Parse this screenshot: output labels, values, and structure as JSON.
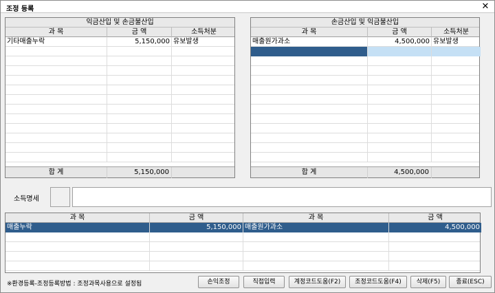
{
  "window": {
    "title": "조정 등록",
    "close_glyph": "✕"
  },
  "left_grid": {
    "title": "익금산입 및 손금불산입",
    "columns": [
      "과    목",
      "금    액",
      "소득처분"
    ],
    "rows": [
      [
        "기타매출누락",
        "5,150,000",
        "유보발생"
      ]
    ],
    "total_label": "합        계",
    "total_value": "5,150,000"
  },
  "right_grid": {
    "title": "손금산입 및 익금불산입",
    "columns": [
      "과    목",
      "금    액",
      "소득처분"
    ],
    "rows": [
      [
        "매출원가과소",
        "4,500,000",
        "유보발생"
      ]
    ],
    "total_label": "합        계",
    "total_value": "4,500,000"
  },
  "income": {
    "label": "소득명세"
  },
  "bottom_grid": {
    "columns": [
      "과    목",
      "금    액",
      "과    목",
      "금    액"
    ],
    "rows": [
      [
        "매출누락",
        "5,150,000",
        "매출원가과소",
        "4,500,000"
      ]
    ]
  },
  "footer": {
    "note": "※환경등록-조정등록방법 : 조정과목사용으로 설정됨",
    "buttons": {
      "adjust": "손익조정",
      "direct": "직접입력",
      "account_help": "계정코드도움(F2)",
      "adjust_help": "조정코드도움(F4)",
      "delete": "삭제(F5)",
      "close": "종료(ESC)"
    }
  }
}
